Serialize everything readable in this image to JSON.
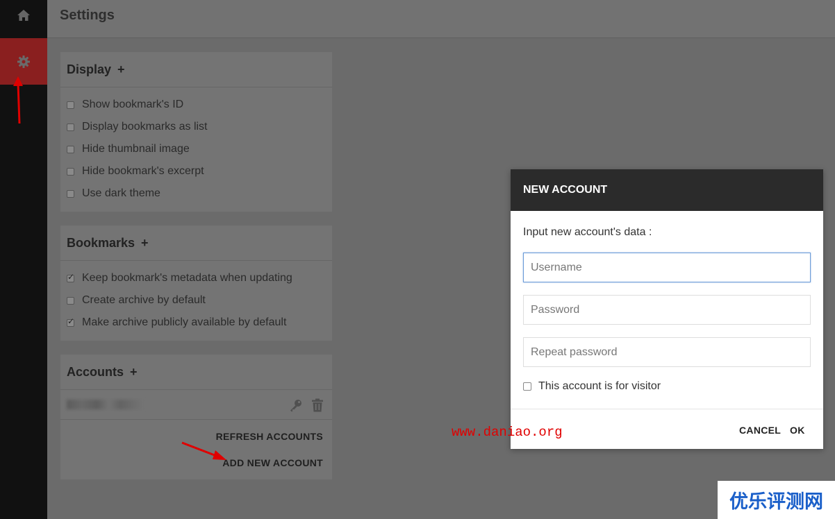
{
  "header": {
    "title": "Settings"
  },
  "sidebar": {
    "items": [
      {
        "icon": "home-icon"
      },
      {
        "icon": "gear-icon",
        "active": true
      }
    ]
  },
  "display_panel": {
    "title": "Display",
    "plus": "+",
    "options": [
      {
        "label": "Show bookmark's ID",
        "checked": false
      },
      {
        "label": "Display bookmarks as list",
        "checked": false
      },
      {
        "label": "Hide thumbnail image",
        "checked": false
      },
      {
        "label": "Hide bookmark's excerpt",
        "checked": false
      },
      {
        "label": "Use dark theme",
        "checked": false
      }
    ]
  },
  "bookmarks_panel": {
    "title": "Bookmarks",
    "plus": "+",
    "options": [
      {
        "label": "Keep bookmark's metadata when updating",
        "checked": true
      },
      {
        "label": "Create archive by default",
        "checked": false
      },
      {
        "label": "Make archive publicly available by default",
        "checked": true
      }
    ]
  },
  "accounts_panel": {
    "title": "Accounts",
    "plus": "+",
    "refresh_label": "REFRESH ACCOUNTS",
    "add_label": "ADD NEW ACCOUNT"
  },
  "dialog": {
    "title": "NEW ACCOUNT",
    "message": "Input new account's data :",
    "username_placeholder": "Username",
    "password_placeholder": "Password",
    "repeat_placeholder": "Repeat password",
    "visitor_label": "This account is for visitor",
    "cancel_label": "CANCEL",
    "ok_label": "OK"
  },
  "watermark": "www.daniao.org",
  "corner_logo": "优乐评测网",
  "colors": {
    "sidebar_bg": "#111111",
    "active_nav": "#8a1f1f",
    "overlay": "#6b6b6b",
    "dialog_header": "#2b2b2b",
    "annotation": "#e00000",
    "logo_text": "#1a5fc9"
  }
}
